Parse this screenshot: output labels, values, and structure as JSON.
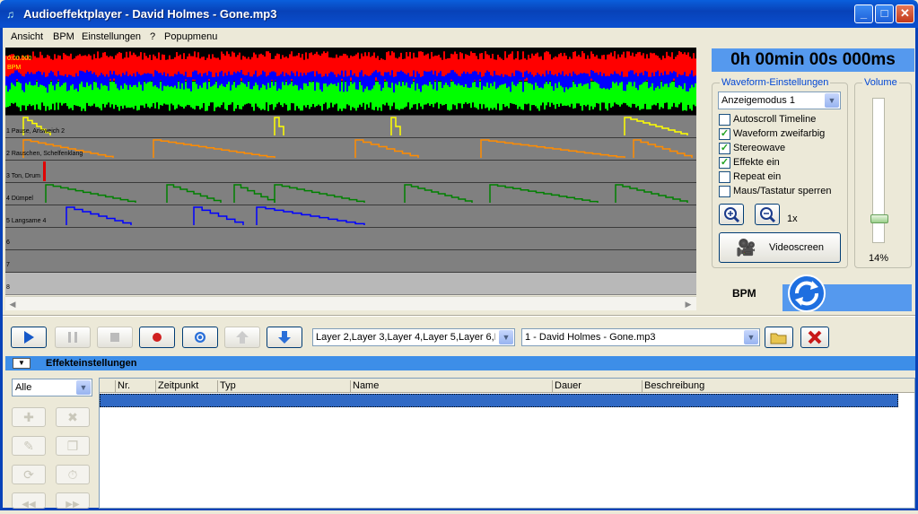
{
  "window": {
    "title": "Audioeffektplayer - David Holmes - Gone.mp3",
    "minimize": "_",
    "maximize": "□",
    "close": "✕"
  },
  "menu": {
    "items": [
      "Ansicht",
      "BPM",
      "Einstellungen",
      "?",
      "Popupmenu"
    ]
  },
  "waveform": {
    "time_label": "0:00.000",
    "bpm_label": "BPM"
  },
  "layers": [
    {
      "name": "1 Pause, Answeich 2"
    },
    {
      "name": "2 Rauschen, Schelfenklang"
    },
    {
      "name": "3 Ton, Drum"
    },
    {
      "name": "4 Dümpel"
    },
    {
      "name": "5 Langsame 4"
    },
    {
      "name": "6"
    },
    {
      "name": "7"
    },
    {
      "name": "8"
    }
  ],
  "clock": "0h 00min 00s 000ms",
  "waveform_settings": {
    "title": "Waveform-Einstellungen",
    "mode": "Anzeigemodus 1",
    "options": [
      {
        "label": "Autoscroll Timeline",
        "checked": false
      },
      {
        "label": "Waveform zweifarbig",
        "checked": true
      },
      {
        "label": "Stereowave",
        "checked": true
      },
      {
        "label": "Effekte ein",
        "checked": true
      },
      {
        "label": "Repeat ein",
        "checked": false
      },
      {
        "label": "Maus/Tastatur sperren",
        "checked": false
      }
    ],
    "zoom_label": "1x",
    "videoscreen_label": "Videoscreen"
  },
  "volume": {
    "title": "Volume",
    "value_label": "14%",
    "level": 0.14
  },
  "bpm_label": "BPM",
  "transport": {
    "layer_select": "Layer 2,Layer 3,Layer 4,Layer 5,Layer 6,La",
    "track_select": "1 - David Holmes - Gone.mp3"
  },
  "effects": {
    "title": "Effekteinstellungen",
    "filter": "Alle",
    "columns": [
      "Nr.",
      "Zeitpunkt",
      "Typ",
      "Name",
      "Dauer",
      "Beschreibung"
    ]
  },
  "colors": {
    "title_bar": "#0a4fd0",
    "accent": "#5599ee",
    "wave_red": "#ff0000",
    "wave_green": "#00ff00",
    "wave_blue": "#0000ff"
  }
}
